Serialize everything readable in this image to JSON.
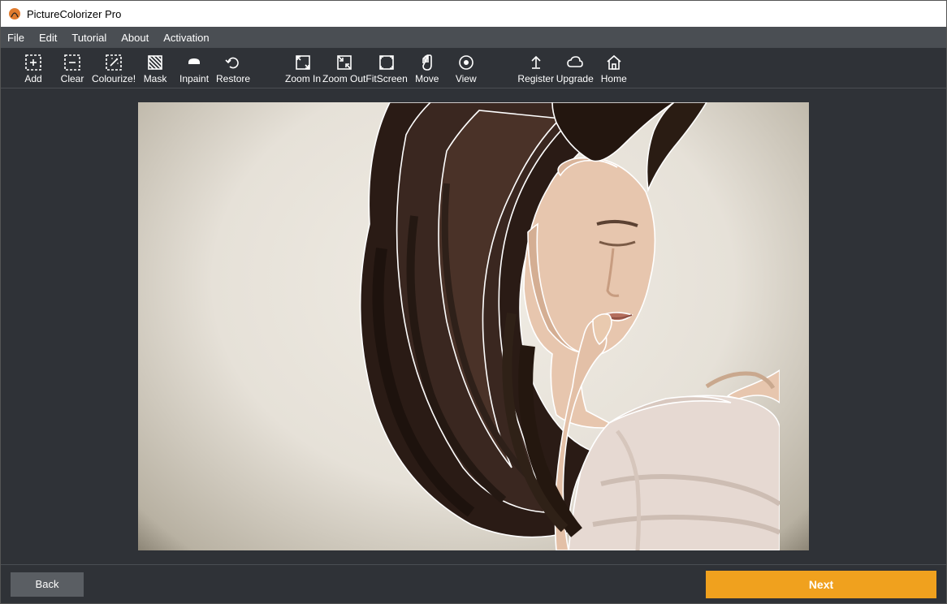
{
  "window": {
    "title": "PictureColorizer Pro"
  },
  "menubar": {
    "items": [
      "File",
      "Edit",
      "Tutorial",
      "About",
      "Activation"
    ]
  },
  "toolbar": {
    "add": "Add",
    "clear": "Clear",
    "colourize": "Colourize!",
    "mask": "Mask",
    "inpaint": "Inpaint",
    "restore": "Restore",
    "zoom_in": "Zoom In",
    "zoom_out": "Zoom Out",
    "fit_screen": "FitScreen",
    "move": "Move",
    "view": "View",
    "register": "Register",
    "upgrade": "Upgrade",
    "home": "Home"
  },
  "buttons": {
    "back": "Back",
    "next": "Next"
  },
  "canvas": {
    "content_description": "Color photograph of a woman with long wavy dark brown hair, eyes closed, off-shoulder top, light studio background with vignette"
  }
}
